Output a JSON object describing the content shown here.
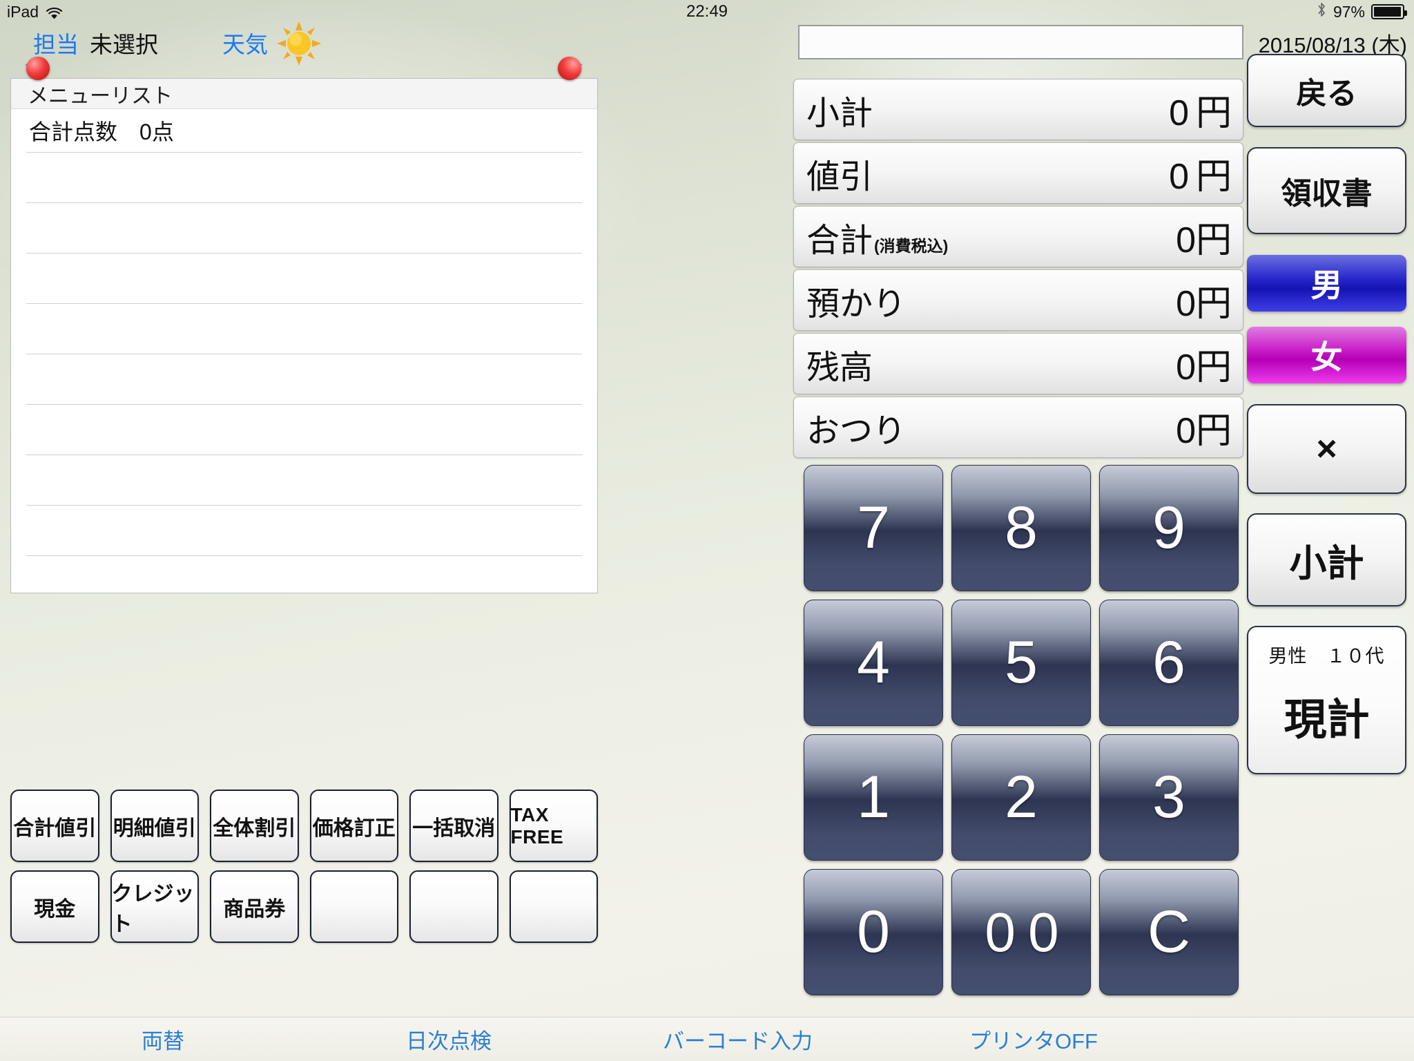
{
  "statusbar": {
    "device": "iPad",
    "wifi_icon": "wifi-icon",
    "time": "22:49",
    "bluetooth_icon": "bluetooth-icon",
    "battery_percent": "97%",
    "battery_icon": "battery-icon"
  },
  "topbar": {
    "staff_label": "担当",
    "staff_value": "未選択",
    "weather_label": "天気",
    "weather_icon": "sun-icon"
  },
  "date": "2015/08/13 (木)",
  "search": {
    "value": "",
    "placeholder": ""
  },
  "menu_panel": {
    "title": "メニューリスト",
    "total_count_label": "合計点数",
    "total_count_value": "0点",
    "empty_rows": 9,
    "pin_icon": "pushpin-icon"
  },
  "totals": [
    {
      "label": "小計",
      "sub": "",
      "value": "0",
      "unit": "円",
      "tight": false
    },
    {
      "label": "値引",
      "sub": "",
      "value": "0",
      "unit": "円",
      "tight": false
    },
    {
      "label": "合計",
      "sub": "(消費税込)",
      "value": "0",
      "unit": "円",
      "tight": true
    },
    {
      "label": "預かり",
      "sub": "",
      "value": "0",
      "unit": "円",
      "tight": true
    },
    {
      "label": "残高",
      "sub": "",
      "value": "0",
      "unit": "円",
      "tight": true
    },
    {
      "label": "おつり",
      "sub": "",
      "value": "0",
      "unit": "円",
      "tight": true
    }
  ],
  "function_buttons_row1": [
    "合計値引",
    "明細値引",
    "全体割引",
    "価格訂正",
    "一括取消",
    "TAX FREE"
  ],
  "function_buttons_row2": [
    "現金",
    "クレジット",
    "商品券",
    "",
    "",
    ""
  ],
  "keypad": [
    "7",
    "8",
    "9",
    "4",
    "5",
    "6",
    "1",
    "2",
    "3",
    "0",
    "0 0",
    "C"
  ],
  "rail": {
    "back": "戻る",
    "receipt": "領収書",
    "male": "男",
    "female": "女",
    "multiply": "×",
    "subtotal": "小計",
    "demographic": "男性　１０代",
    "cash_total": "現計"
  },
  "bottombar": {
    "exchange": "両替",
    "daily_check": "日次点検",
    "barcode_input": "バーコード入力",
    "printer": "プリンタOFF"
  },
  "colors": {
    "link_blue": "#2a7fd4",
    "male_blue": "#2323c8",
    "female_magenta": "#c81bc8",
    "key_navy": "#2e3552"
  }
}
